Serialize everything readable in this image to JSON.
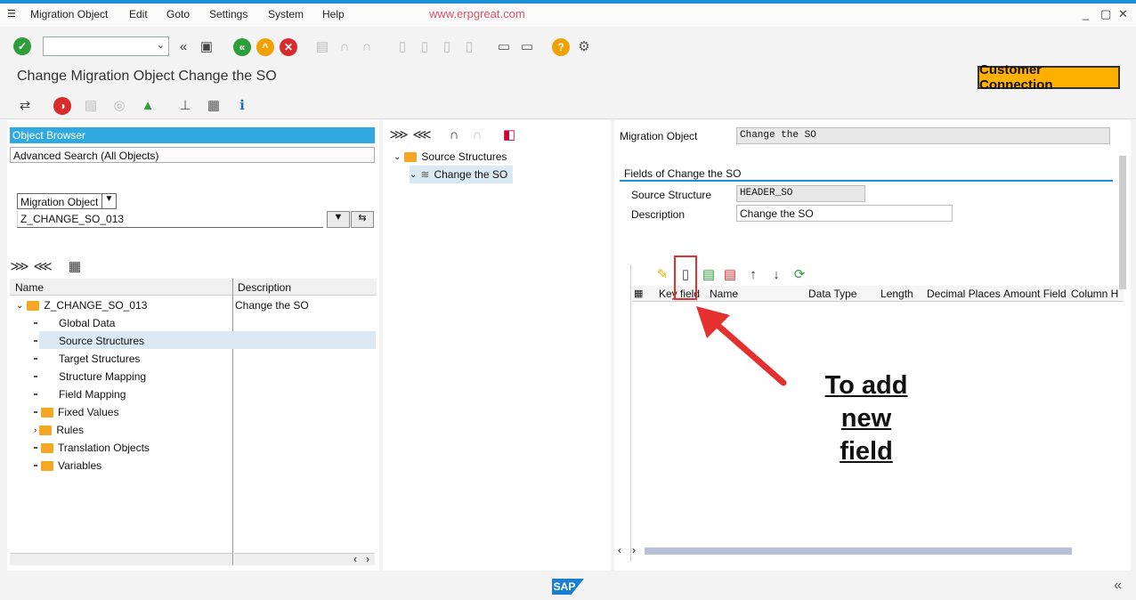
{
  "menu": {
    "items": [
      "Migration Object",
      "Edit",
      "Goto",
      "Settings",
      "System",
      "Help"
    ],
    "watermark": "www.erpgreat.com"
  },
  "title": {
    "text": "Change Migration Object Change the SO",
    "customer_connection": "Customer Connection"
  },
  "left_panel": {
    "object_browser": "Object Browser",
    "advanced_search": "Advanced Search (All Objects)",
    "selector_label": "Migration Object",
    "selector_value": "Z_CHANGE_SO_013",
    "columns": {
      "name": "Name",
      "description": "Description"
    },
    "tree": [
      {
        "label": "Z_CHANGE_SO_013",
        "description": "Change the SO"
      },
      {
        "label": "Global Data"
      },
      {
        "label": "Source Structures"
      },
      {
        "label": "Target Structures"
      },
      {
        "label": "Structure Mapping"
      },
      {
        "label": "Field Mapping"
      },
      {
        "label": "Fixed Values"
      },
      {
        "label": "Rules"
      },
      {
        "label": "Translation Objects"
      },
      {
        "label": "Variables"
      }
    ]
  },
  "mid_panel": {
    "root": "Source Structures",
    "child": "Change the SO"
  },
  "right_panel": {
    "migration_object_label": "Migration Object",
    "migration_object_value": "Change the SO",
    "section_title": "Fields of Change the SO",
    "source_structure_label": "Source Structure",
    "source_structure_value": "HEADER_SO",
    "description_label": "Description",
    "description_value": "Change the SO",
    "table_columns": [
      "Key field",
      "Name",
      "Data Type",
      "Length",
      "Decimal Places",
      "Amount Field",
      "Column H"
    ]
  },
  "annotation": {
    "line1": "To add",
    "line2": "new",
    "line3": "field"
  },
  "status": {
    "sap_logo": "SAP",
    "nav": "«"
  }
}
